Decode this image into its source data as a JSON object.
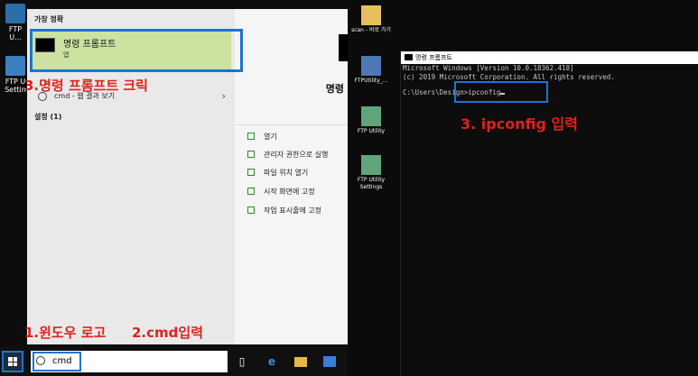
{
  "left_desktop_icons": [
    {
      "label": "FTP U...",
      "color": "#2b6ea8"
    },
    {
      "label": "FTP U Settin",
      "color": "#3d7fc2"
    }
  ],
  "search_results": {
    "best_match_heading": "가장 정확",
    "best_match_title": "명령 프롬프트",
    "best_match_subtitle": "앱",
    "web_query": "cmd - 웹 결과 보기",
    "settings_heading": "설정 (1)"
  },
  "detail_pane": {
    "app_name": "명령",
    "actions": [
      "열기",
      "관리자 권한으로 실행",
      "파일 위치 열기",
      "시작 화면에 고정",
      "작업 표시줄에 고정"
    ]
  },
  "annotations": {
    "click_prompt": "3.명령 프롬프트 크릭",
    "step1": "1.윈도우 로고",
    "step2": "2.cmd입력",
    "step3": "3. ipconfig 입력"
  },
  "taskbar": {
    "search_value": "cmd",
    "icons": [
      "task-view-icon",
      "edge-icon",
      "file-explorer-icon",
      "store-icon"
    ]
  },
  "right_desktop_icons": [
    {
      "label": "scan - 바로 가기",
      "color": "#e5c05c"
    },
    {
      "label": "FTPUtility_...",
      "color": "#4d78b5"
    },
    {
      "label": "FTP Utility",
      "color": "#5fa57a"
    },
    {
      "label": "FTP Utility Settings",
      "color": "#5fa57a"
    }
  ],
  "cmd_window": {
    "title": "명령 프롬프트",
    "line1": "Microsoft Windows [Version 10.0.18362.418]",
    "line2": "(c) 2019 Microsoft Corporation. All rights reserved.",
    "prompt": "C:\\Users\\Design>",
    "command": "ipconfig"
  },
  "colors": {
    "highlight_box": "#1e73d2",
    "annotation_text": "#e0211d",
    "best_match_bg": "#cbe2a0"
  }
}
